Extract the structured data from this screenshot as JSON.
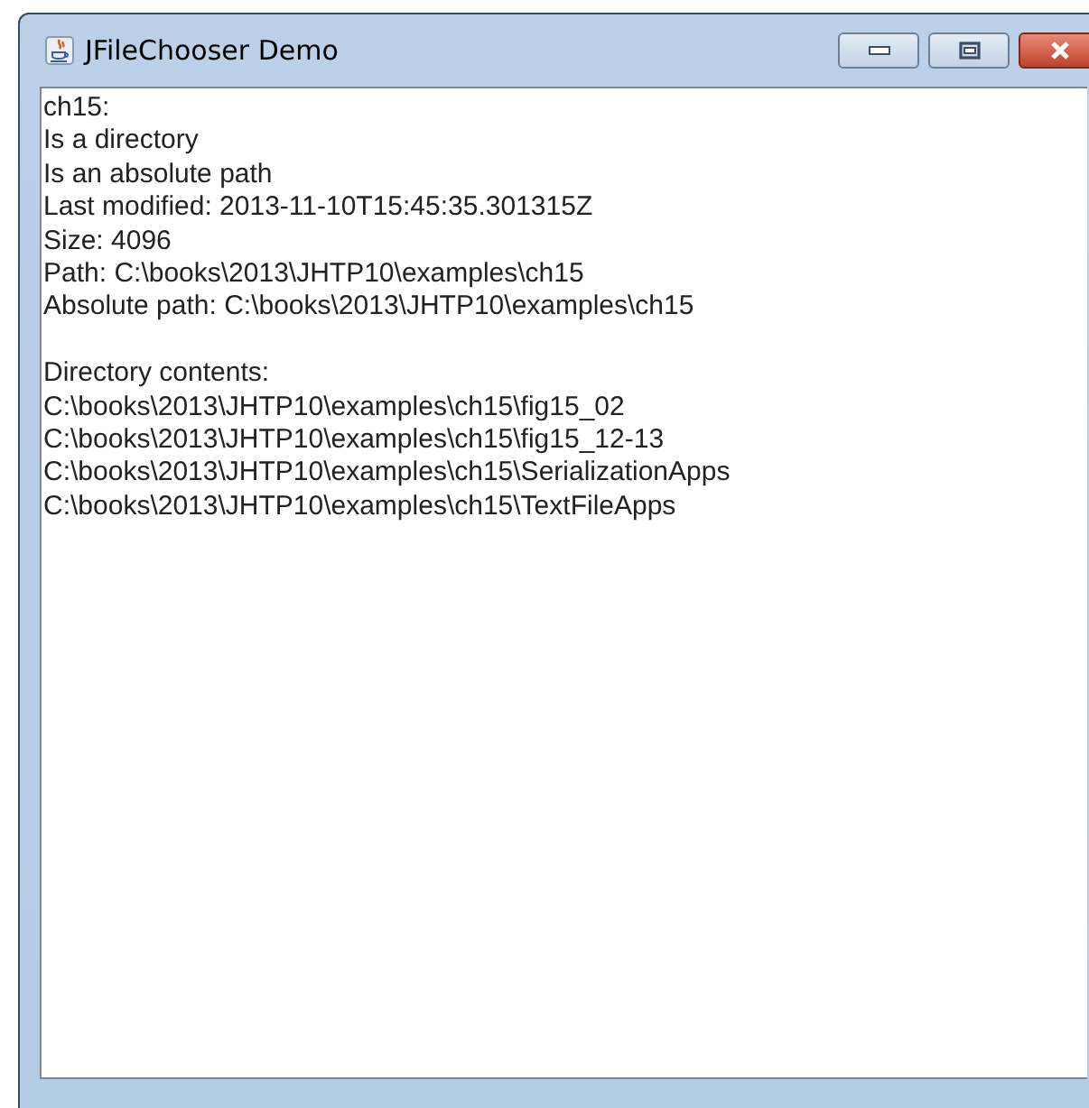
{
  "window": {
    "title": "JFileChooser Demo"
  },
  "text_area": {
    "info_lines": [
      "ch15:",
      "Is a directory",
      "Is an absolute path",
      "Last modified: 2013-11-10T15:45:35.301315Z",
      "Size: 4096",
      "Path: C:\\books\\2013\\JHTP10\\examples\\ch15",
      "Absolute path: C:\\books\\2013\\JHTP10\\examples\\ch15"
    ],
    "contents_lines": [
      "Directory contents:",
      "C:\\books\\2013\\JHTP10\\examples\\ch15\\fig15_02",
      "C:\\books\\2013\\JHTP10\\examples\\ch15\\fig15_12-13",
      "C:\\books\\2013\\JHTP10\\examples\\ch15\\SerializationApps",
      "C:\\books\\2013\\JHTP10\\examples\\ch15\\TextFileApps"
    ]
  }
}
